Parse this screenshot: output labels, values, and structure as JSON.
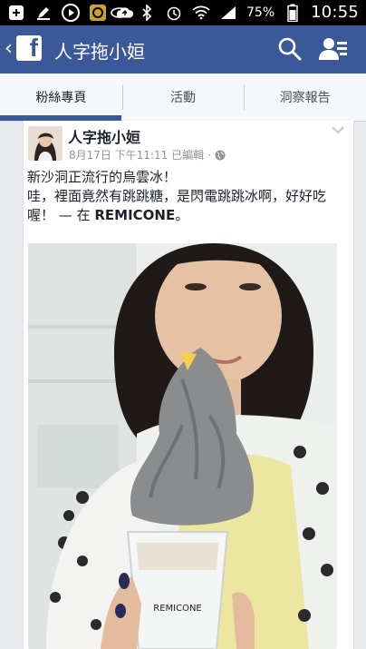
{
  "status_bar": {
    "battery_percent": "75%",
    "time": "10:55",
    "icons_left": [
      "add-icon",
      "edit-icon",
      "play-icon",
      "media-icon",
      "cloud-upload-icon"
    ],
    "icons_right": [
      "eye-icon",
      "bluetooth-icon",
      "alarm-icon",
      "wifi-icon",
      "signal-icon",
      "battery-icon"
    ]
  },
  "header": {
    "logo_letter": "f",
    "title": "人字拖小姮",
    "accent": "#3b5998"
  },
  "tabs": [
    {
      "label": "粉絲專頁",
      "active": true
    },
    {
      "label": "活動",
      "active": false
    },
    {
      "label": "洞察報告",
      "active": false
    }
  ],
  "post": {
    "author": "人字拖小姮",
    "timestamp": "8月17日 下午11:11 已編輯",
    "text_line1": "新沙洞正流行的烏雲冰！",
    "text_line2": "哇，裡面竟然有跳跳糖，是閃電跳跳冰啊，好好吃喔！",
    "at_prefix": "— 在",
    "place": "REMICONE",
    "place_suffix": "。",
    "cup_brand": "REMICONE"
  }
}
